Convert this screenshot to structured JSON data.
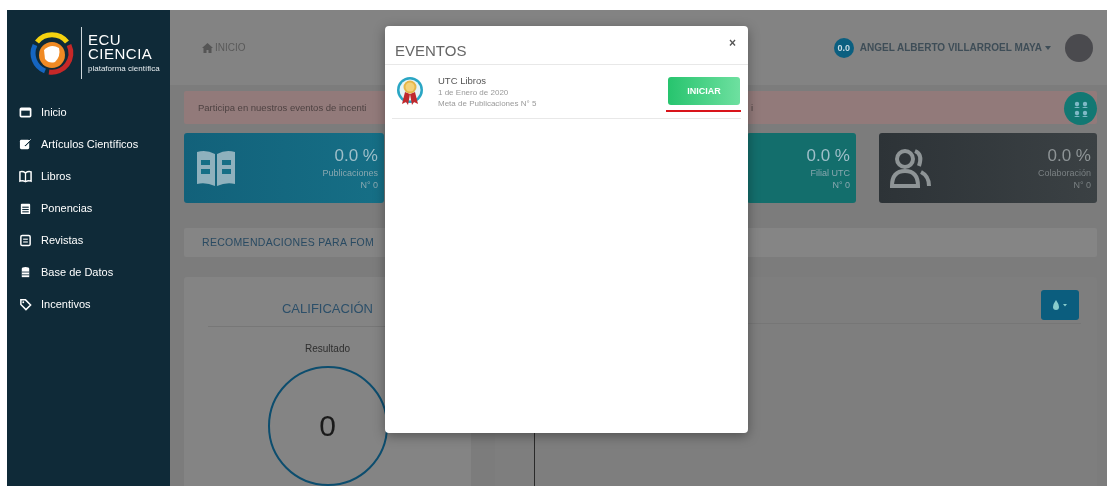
{
  "sidebar": {
    "logo": {
      "line1": "ECU",
      "line2": "CIENCIA",
      "tagline": "plataforma científica"
    },
    "items": [
      {
        "label": "Inicio"
      },
      {
        "label": "Artículos Científicos"
      },
      {
        "label": "Libros"
      },
      {
        "label": "Ponencias"
      },
      {
        "label": "Revistas"
      },
      {
        "label": "Base de Datos"
      },
      {
        "label": "Incentivos"
      }
    ]
  },
  "topbar": {
    "breadcrumb": "INICIO",
    "score_badge": "0.0",
    "user_name": "ANGEL ALBERTO VILLARROEL MAYA"
  },
  "alert": {
    "text": "Participa en nuestros eventos de incenti",
    "text_end": "i"
  },
  "stat_cards": [
    {
      "kind": "book",
      "percent": "0.0 %",
      "label": "Publicaciones",
      "count": "N° 0"
    },
    {
      "kind": "partial",
      "percent": "0.0 %",
      "label": "Filial UTC",
      "count": "N° 0"
    },
    {
      "kind": "people",
      "percent": "0.0 %",
      "label": "Colaboración",
      "count": "N° 0"
    }
  ],
  "recommendations": {
    "title": "RECOMENDACIONES PARA FOM"
  },
  "rating": {
    "title": "CALIFICACIÓN",
    "subtitle": "Resultado",
    "value": "0"
  },
  "modal": {
    "title": "EVENTOS",
    "close": "×",
    "events": [
      {
        "name": "UTC Libros",
        "date": "1 de Enero de 2020",
        "goal": "Meta de Publicaciones N° 5",
        "action": "INICIAR"
      }
    ]
  }
}
